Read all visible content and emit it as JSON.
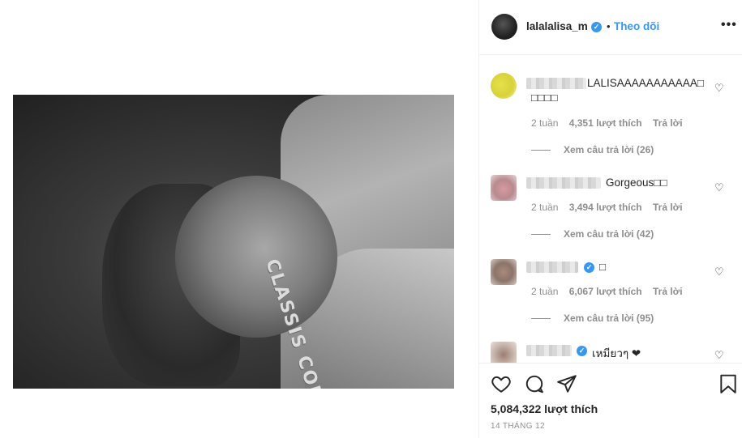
{
  "post": {
    "image_text": "CLASSIS COMING",
    "author": {
      "username": "lalalalisa_m",
      "verified": true
    },
    "header": {
      "dot": "•",
      "follow_label": "Theo dõi",
      "more_label": "•••"
    },
    "comments": [
      {
        "text_line1": "LALISAAAAAAAAAAA□",
        "text_line2": "□□□□",
        "time": "2 tuần",
        "likes": "4,351 lượt thích",
        "reply_label": "Trả lời",
        "view_replies": "Xem câu trả lời (26)",
        "verified": false
      },
      {
        "text_line1": "Gorgeous□□",
        "text_line2": "",
        "time": "2 tuần",
        "likes": "3,494 lượt thích",
        "reply_label": "Trả lời",
        "view_replies": "Xem câu trả lời (42)",
        "verified": false
      },
      {
        "text_line1": "□",
        "text_line2": "",
        "time": "2 tuần",
        "likes": "6,067 lượt thích",
        "reply_label": "Trả lời",
        "view_replies": "Xem câu trả lời (95)",
        "verified": true
      },
      {
        "text_line1": "เหมียวๆ ❤",
        "text_line2": "",
        "verified": true
      }
    ],
    "total_likes": "5,084,322 lượt thích",
    "date": "14 THÁNG 12",
    "icons": {
      "like": "heart-icon",
      "comment": "comment-icon",
      "share": "send-icon",
      "save": "bookmark-icon",
      "comment_like": "heart-outline-icon",
      "verified": "verified-badge-icon"
    },
    "colors": {
      "accent": "#3897f0",
      "text": "#262626",
      "muted": "#8e8e8e",
      "border": "#efefef"
    }
  }
}
